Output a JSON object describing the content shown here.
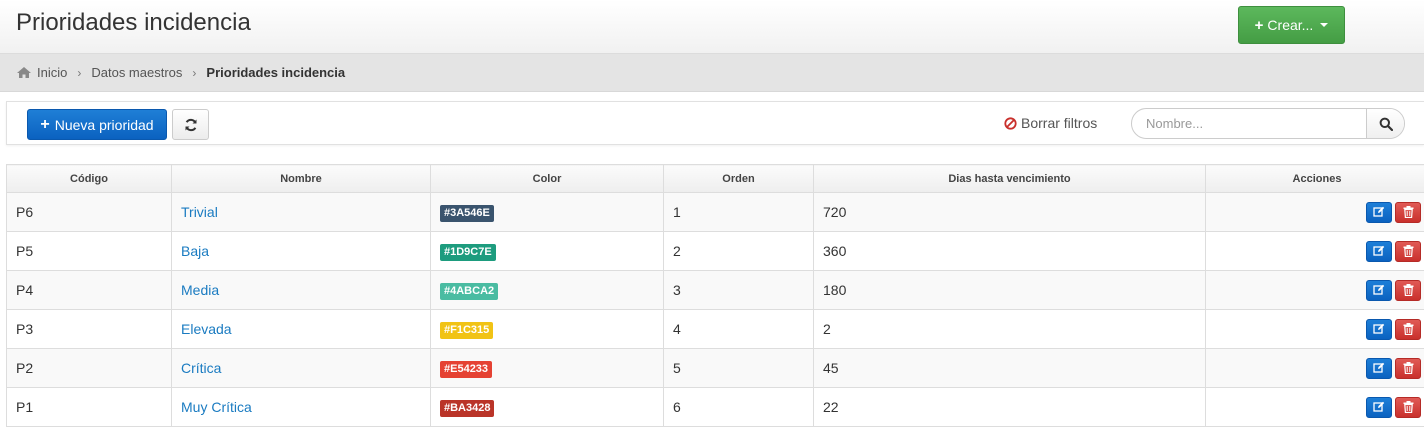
{
  "header": {
    "title": "Prioridades incidencia",
    "create_label": "Crear..."
  },
  "breadcrumb": {
    "home": "Inicio",
    "master": "Datos maestros",
    "current": "Prioridades incidencia"
  },
  "toolbar": {
    "new_label": "Nueva prioridad",
    "clear_filters": "Borrar filtros",
    "search_placeholder": "Nombre..."
  },
  "table": {
    "columns": [
      "Código",
      "Nombre",
      "Color",
      "Orden",
      "Dias hasta vencimiento",
      "Acciones"
    ],
    "rows": [
      {
        "code": "P6",
        "name": "Trivial",
        "color": "#3A546E",
        "order": "1",
        "days": "720"
      },
      {
        "code": "P5",
        "name": "Baja",
        "color": "#1D9C7E",
        "order": "2",
        "days": "360"
      },
      {
        "code": "P4",
        "name": "Media",
        "color": "#4ABCA2",
        "order": "3",
        "days": "180"
      },
      {
        "code": "P3",
        "name": "Elevada",
        "color": "#F1C315",
        "order": "4",
        "days": "2"
      },
      {
        "code": "P2",
        "name": "Crítica",
        "color": "#E54233",
        "order": "5",
        "days": "45"
      },
      {
        "code": "P1",
        "name": "Muy Crítica",
        "color": "#BA3428",
        "order": "6",
        "days": "22"
      }
    ]
  },
  "icons": {
    "home": "home-icon",
    "plus": "plus-icon",
    "refresh": "refresh-icon",
    "ban": "ban-icon",
    "search": "search-icon",
    "edit": "edit-icon",
    "delete": "trash-icon"
  },
  "colors": {
    "create_button": "#5cb85c",
    "primary": "#0b62c0",
    "danger": "#c9302c",
    "link": "#1a7bc1"
  }
}
